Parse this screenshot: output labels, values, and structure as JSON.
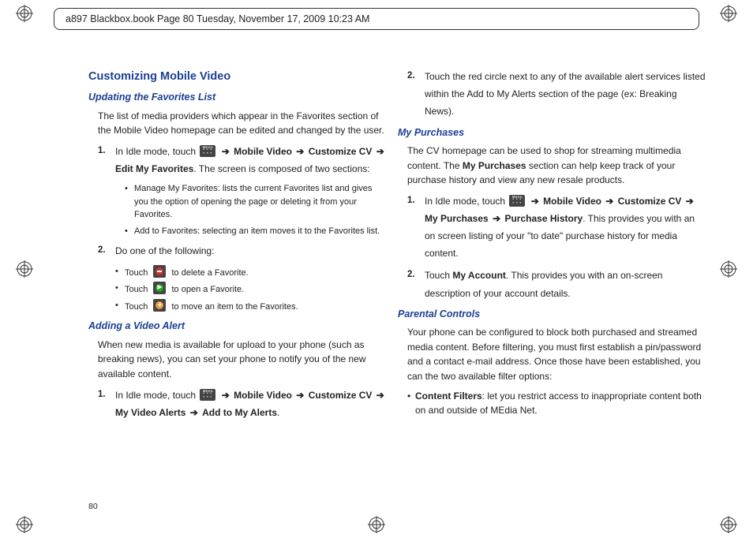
{
  "header": {
    "text": "a897 Blackbox.book  Page 80  Tuesday, November 17, 2009  10:23 AM"
  },
  "page_number": "80",
  "arrow": "➔",
  "icons": {
    "menu": "Menu",
    "delete": "delete-icon",
    "open": "open-icon",
    "move": "move-icon"
  },
  "left": {
    "h1": "Customizing Mobile Video",
    "sec1": {
      "title": "Updating the Favorites List",
      "intro": "The list of media providers which appear in the Favorites section of the Mobile Video homepage can be edited and changed by the user.",
      "step1_pre": "In Idle mode, touch ",
      "step1_a": "Mobile Video",
      "step1_b": "Customize CV",
      "step1_c": "Edit My Favorites",
      "step1_post": ". The screen is composed of two sections:",
      "bullet1": "Manage My Favorites: lists the current Favorites list and gives you the option of opening the page or deleting it from your Favorites.",
      "bullet2": "Add to Favorites: selecting an item moves it to the Favorites list.",
      "step2": "Do one of the following:",
      "touch": "Touch",
      "act_delete": "to delete a Favorite.",
      "act_open": "to open a Favorite.",
      "act_move": "to move an item to the Favorites."
    },
    "sec2": {
      "title": "Adding a Video Alert",
      "intro": "When new media is available for upload to your phone (such as breaking news), you can set your phone to notify you of the new available content.",
      "step1_pre": "In Idle mode, touch ",
      "step1_a": "Mobile Video",
      "step1_b": "Customize CV",
      "step1_c": "My Video Alerts",
      "step1_d": "Add to My Alerts",
      "step1_post": "."
    }
  },
  "right": {
    "step2_cont": "Touch the red circle next to any of the available alert services listed within the Add to My Alerts section of the page (ex: Breaking News).",
    "sec1": {
      "title": "My Purchases",
      "intro_a": "The CV homepage can be used to shop for streaming multimedia content. The ",
      "intro_bold": "My Purchases",
      "intro_b": " section can help keep track of your purchase history and view any new resale products.",
      "step1_pre": "In Idle mode, touch ",
      "step1_a": "Mobile Video",
      "step1_b": "Customize CV",
      "step1_c": "My Purchases",
      "step1_d": "Purchase History",
      "step1_post": ". This provides you with an on screen listing of your \"to date\" purchase history for media content.",
      "step2_a": "Touch ",
      "step2_bold": "My Account",
      "step2_b": ". This provides you with an on-screen description of your account details."
    },
    "sec2": {
      "title": "Parental Controls",
      "intro": "Your phone can be configured to block both purchased and streamed media content. Before filtering, you must first establish a pin/password and a contact e-mail address. Once those have been established, you can the two available filter options:",
      "bullet_label": "Content Filters",
      "bullet_text": ": let you restrict access to inappropriate content both on and outside of MEdia Net."
    }
  }
}
